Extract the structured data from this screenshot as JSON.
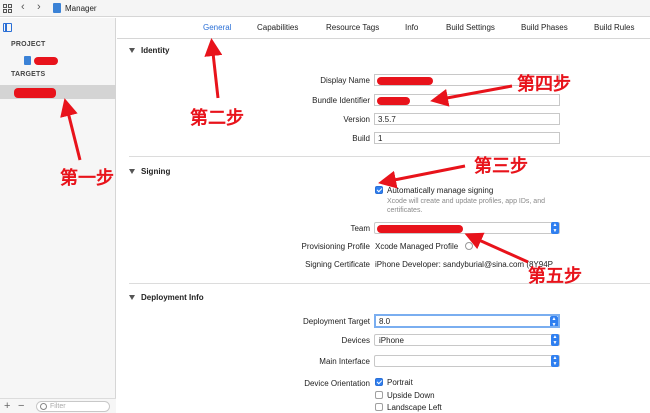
{
  "window": {
    "title": "Manager",
    "nav_back": "‹",
    "nav_forward": "›"
  },
  "navigator": {
    "project_heading": "PROJECT",
    "targets_heading": "TARGETS",
    "filter_placeholder": "Filter",
    "add_label": "+",
    "remove_label": "−"
  },
  "tabs": [
    {
      "label": "General",
      "active": true
    },
    {
      "label": "Capabilities"
    },
    {
      "label": "Resource Tags"
    },
    {
      "label": "Info"
    },
    {
      "label": "Build Settings"
    },
    {
      "label": "Build Phases"
    },
    {
      "label": "Build Rules"
    }
  ],
  "identity": {
    "header": "Identity",
    "display_name_label": "Display Name",
    "bundle_id_label": "Bundle Identifier",
    "version_label": "Version",
    "version_value": "3.5.7",
    "build_label": "Build",
    "build_value": "1"
  },
  "signing": {
    "header": "Signing",
    "auto_manage_label": "Automatically manage signing",
    "auto_manage_checked": true,
    "auto_manage_hint": "Xcode will create and update profiles, app IDs, and certificates.",
    "team_label": "Team",
    "profile_label": "Provisioning Profile",
    "profile_value": "Xcode Managed Profile",
    "certificate_label": "Signing Certificate",
    "certificate_value": "iPhone Developer: sandyburial@sina.com (8Y94P"
  },
  "deployment": {
    "header": "Deployment Info",
    "target_label": "Deployment Target",
    "target_value": "8.0",
    "devices_label": "Devices",
    "devices_value": "iPhone",
    "main_interface_label": "Main Interface",
    "main_interface_value": "",
    "orientation_label": "Device Orientation",
    "orientations": [
      {
        "label": "Portrait",
        "checked": true
      },
      {
        "label": "Upside Down",
        "checked": false
      },
      {
        "label": "Landscape Left",
        "checked": false
      }
    ]
  },
  "annotations": {
    "step1": "第一步",
    "step2": "第二步",
    "step3": "第三步",
    "step4": "第四步",
    "step5": "第五步"
  },
  "colors": {
    "accent": "#2a6fd6",
    "annotation": "#e8131b",
    "checkbox": "#2f7ff0"
  }
}
